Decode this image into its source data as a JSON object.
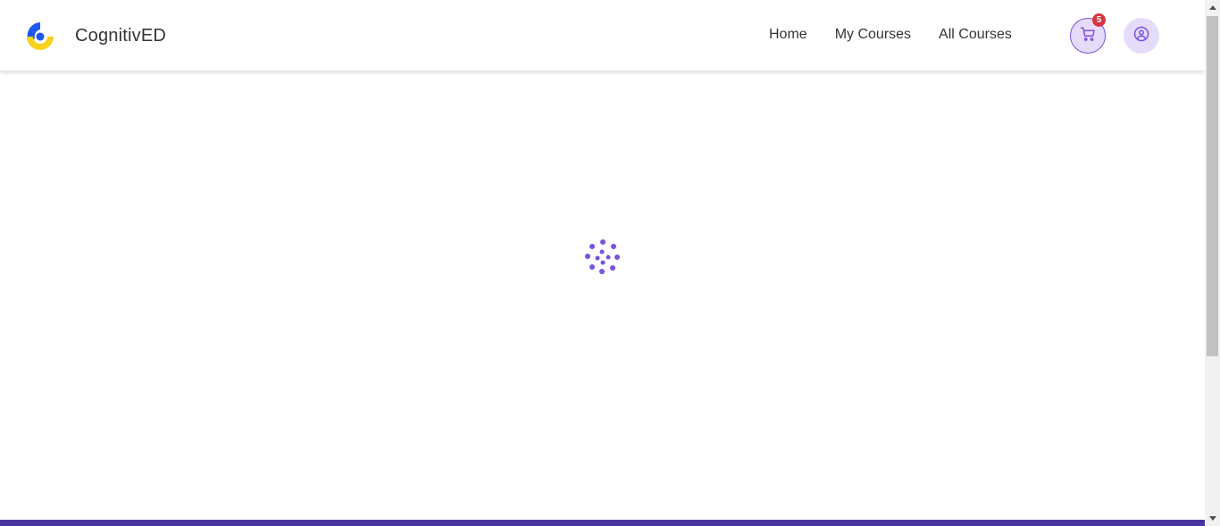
{
  "brand": {
    "name": "CognitivED",
    "logo_icon": "cognitived-logo-icon"
  },
  "nav": {
    "links": [
      "Home",
      "My Courses",
      "All Courses"
    ]
  },
  "cart": {
    "icon": "cart-icon",
    "count": "5"
  },
  "profile": {
    "icon": "user-circle-icon"
  },
  "loader": {
    "icon": "loading-spinner-icon"
  },
  "colors": {
    "accent": "#7b4fe0",
    "accent_light": "#e5dcfb",
    "badge": "#d4363f",
    "footer": "#4a35a0",
    "logo_blue": "#1f57f5",
    "logo_yellow": "#f7d21e"
  }
}
